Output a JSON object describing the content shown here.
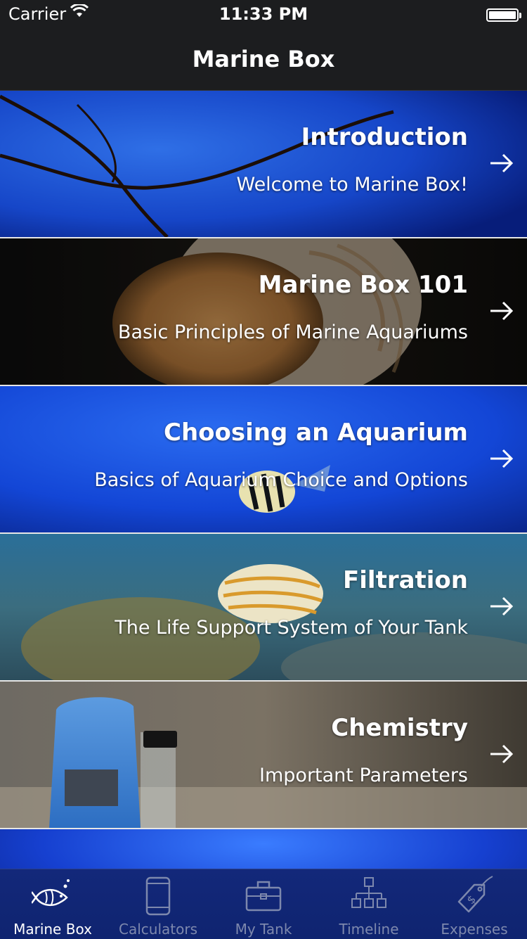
{
  "status_bar": {
    "carrier": "Carrier",
    "time": "11:33 PM"
  },
  "nav": {
    "title": "Marine Box"
  },
  "cells": [
    {
      "title": "Introduction",
      "subtitle": "Welcome to Marine Box!"
    },
    {
      "title": "Marine Box 101",
      "subtitle": "Basic Principles of Marine Aquariums"
    },
    {
      "title": "Choosing an Aquarium",
      "subtitle": "Basics of Aquarium Choice and Options"
    },
    {
      "title": "Filtration",
      "subtitle": "The Life Support System of Your Tank"
    },
    {
      "title": "Chemistry",
      "subtitle": "Important Parameters"
    },
    {
      "title": "",
      "subtitle": ""
    }
  ],
  "tabs": [
    {
      "label": "Marine Box",
      "icon": "fish-icon",
      "active": true
    },
    {
      "label": "Calculators",
      "icon": "phone-icon",
      "active": false
    },
    {
      "label": "My Tank",
      "icon": "toolbox-icon",
      "active": false
    },
    {
      "label": "Timeline",
      "icon": "hierarchy-icon",
      "active": false
    },
    {
      "label": "Expenses",
      "icon": "price-tag-icon",
      "active": false
    }
  ],
  "colors": {
    "nav_background": "#1c1d1f",
    "tab_bar_background": "#13287a",
    "tab_inactive": "#7d88ad",
    "tab_active": "#ffffff"
  }
}
